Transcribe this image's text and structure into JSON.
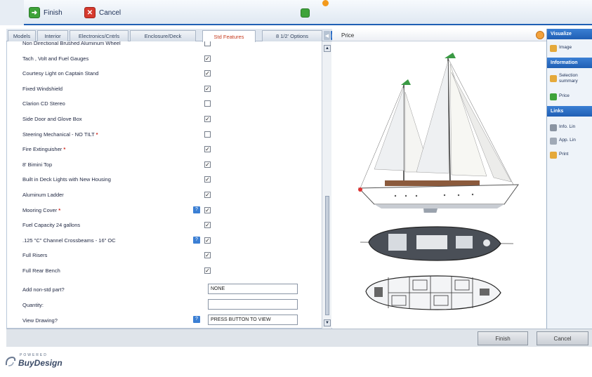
{
  "toolbar": {
    "finish_label": "Finish",
    "cancel_label": "Cancel"
  },
  "tabs": [
    {
      "label": "Models",
      "active": false
    },
    {
      "label": "Interior",
      "active": false
    },
    {
      "label": "Electronics/Cntrls",
      "active": false
    },
    {
      "label": "Enclosure/Deck",
      "active": false
    },
    {
      "label": "Std Features",
      "active": true
    },
    {
      "label": "8 1/2' Options",
      "active": false
    }
  ],
  "features": [
    {
      "label": "Non Directional Brushed Aluminum Wheel",
      "required": false,
      "checked": false,
      "info": false
    },
    {
      "label": "Tach , Volt and Fuel Gauges",
      "required": false,
      "checked": true,
      "info": false
    },
    {
      "label": "Courtesy Light on Captain Stand",
      "required": false,
      "checked": true,
      "info": false
    },
    {
      "label": "Fixed Windshield",
      "required": false,
      "checked": true,
      "info": false
    },
    {
      "label": "Clarion CD Stereo",
      "required": false,
      "checked": false,
      "info": false
    },
    {
      "label": "Side Door and Glove Box",
      "required": false,
      "checked": true,
      "info": false
    },
    {
      "label": "Steering Mechanical - NO TILT",
      "required": true,
      "checked": false,
      "info": false
    },
    {
      "label": "Fire Extinguisher",
      "required": true,
      "checked": true,
      "info": false
    },
    {
      "label": "8' Bimini Top",
      "required": false,
      "checked": true,
      "info": false
    },
    {
      "label": "Built in Deck Lights with New Housing",
      "required": false,
      "checked": true,
      "info": false
    },
    {
      "label": "Aluminum Ladder",
      "required": false,
      "checked": true,
      "info": false
    },
    {
      "label": "Mooring Cover",
      "required": true,
      "checked": true,
      "info": true
    },
    {
      "label": "Fuel Capacity 24 gallons",
      "required": false,
      "checked": true,
      "info": false
    },
    {
      "label": ".125 \"C\" Channel Crossbeams - 16\" OC",
      "required": false,
      "checked": true,
      "info": true
    },
    {
      "label": "Full Risers",
      "required": false,
      "checked": true,
      "info": false
    },
    {
      "label": "Full Rear Bench",
      "required": false,
      "checked": true,
      "info": false
    }
  ],
  "required_marker": "*",
  "check_mark": "✓",
  "info_mark": "?",
  "inputs": {
    "non_std_part": {
      "label": "Add non-std part?",
      "value": "NONE"
    },
    "quantity": {
      "label": "Quantity:",
      "value": ""
    },
    "view_drawing": {
      "label": "View Drawing?",
      "value": "PRESS BUTTON TO VIEW"
    }
  },
  "image_panel": {
    "title": "Price"
  },
  "sidebar": {
    "visualize": {
      "title": "Visualize",
      "items": [
        {
          "label": "Image",
          "icon": "image-icon"
        }
      ]
    },
    "information": {
      "title": "Information",
      "items": [
        {
          "label": "Selection summary",
          "icon": "summary-icon"
        },
        {
          "label": "Price",
          "icon": "price-icon"
        }
      ]
    },
    "links": {
      "title": "Links",
      "items": [
        {
          "label": "Info. Lin",
          "icon": "info-link-icon"
        },
        {
          "label": "App. Lin",
          "icon": "app-link-icon"
        },
        {
          "label": "Print",
          "icon": "print-icon"
        }
      ]
    }
  },
  "bottom": {
    "finish_label": "Finish",
    "cancel_label": "Cancel"
  },
  "logo": {
    "powered": "POWERED",
    "brand": "BuyDesign"
  },
  "colors": {
    "accent_blue": "#1f5fb4",
    "active_tab_text": "#c53a1e",
    "required_red": "#d0281e",
    "finish_green": "#3ea33a",
    "cancel_red": "#d63a2e"
  }
}
